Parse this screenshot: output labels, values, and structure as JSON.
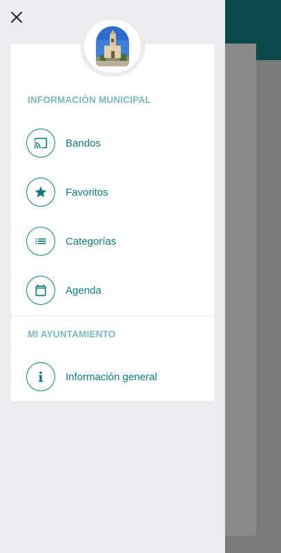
{
  "drawer": {
    "close_label": "×",
    "sections": [
      {
        "title": "INFORMACIÓN MUNICIPAL",
        "items": [
          {
            "label": "Bandos",
            "icon": "cast-icon"
          },
          {
            "label": "Favoritos",
            "icon": "star-icon"
          },
          {
            "label": "Categorías",
            "icon": "list-icon"
          },
          {
            "label": "Agenda",
            "icon": "calendar-icon"
          }
        ]
      },
      {
        "title": "MI AYUNTAMIENTO",
        "items": [
          {
            "label": "Información general",
            "icon": "info-icon"
          }
        ]
      }
    ]
  },
  "colors": {
    "accent": "#0e7a7a",
    "section_title": "#7ab8bf",
    "app_bar": "#0b4a4a"
  }
}
